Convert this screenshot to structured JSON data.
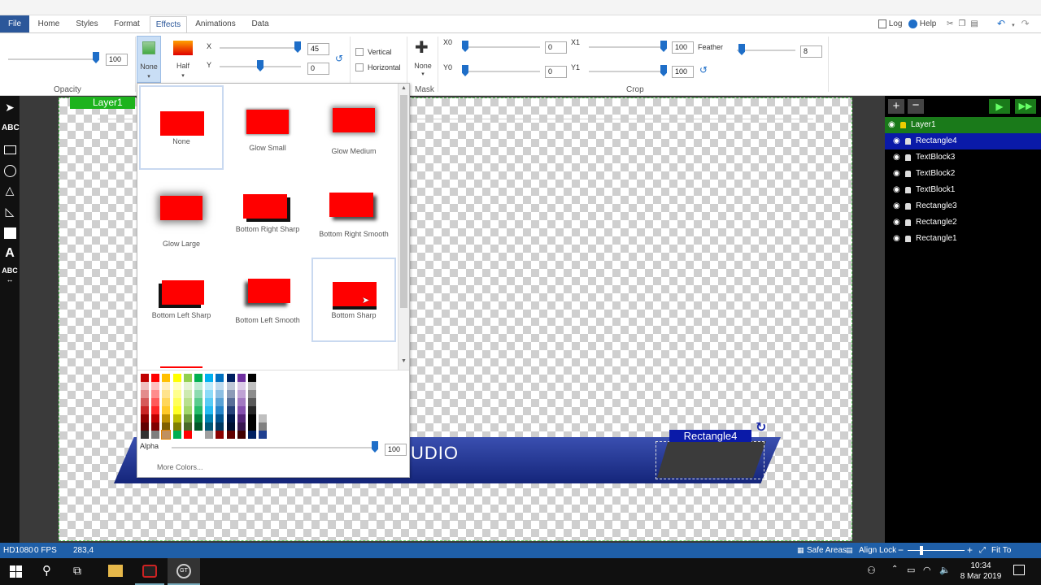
{
  "menu": {
    "tabs": [
      "File",
      "Home",
      "Styles",
      "Format",
      "Effects",
      "Animations",
      "Data"
    ],
    "active_tab": "Effects",
    "right": {
      "log": "Log",
      "help": "Help"
    }
  },
  "ribbon": {
    "opacity": {
      "label": "Opacity",
      "value": "100"
    },
    "shadow": {
      "none_label": "None",
      "half_label": "Half"
    },
    "xy": {
      "x_label": "X",
      "x_value": "45",
      "y_label": "Y",
      "y_value": "0"
    },
    "flip": {
      "vertical": "Vertical",
      "horizontal": "Horizontal"
    },
    "mask": {
      "label": "Mask",
      "none_label": "None"
    },
    "crop": {
      "label": "Crop",
      "x0_label": "X0",
      "x0_value": "0",
      "y0_label": "Y0",
      "y0_value": "0",
      "x1_label": "X1",
      "x1_value": "100",
      "y1_label": "Y1",
      "y1_value": "100",
      "feather_label": "Feather",
      "feather_value": "8"
    }
  },
  "canvas": {
    "layer_tag": "Layer1",
    "banner_text": "UDIO",
    "selected_tag": "Rectangle4"
  },
  "effects_dropdown": {
    "items": [
      {
        "label": "None"
      },
      {
        "label": "Glow Small"
      },
      {
        "label": "Glow Medium"
      },
      {
        "label": "Glow Large"
      },
      {
        "label": "Bottom Right Sharp"
      },
      {
        "label": "Bottom Right Smooth"
      },
      {
        "label": "Bottom Left Sharp"
      },
      {
        "label": "Bottom Left Smooth"
      },
      {
        "label": "Bottom Sharp"
      }
    ],
    "selected": "Bottom Sharp",
    "alpha_label": "Alpha",
    "alpha_value": "100",
    "more_colors": "More Colors..."
  },
  "layers_panel": {
    "items": [
      "Layer1",
      "Rectangle4",
      "TextBlock3",
      "TextBlock2",
      "TextBlock1",
      "Rectangle3",
      "Rectangle2",
      "Rectangle1"
    ],
    "selected": "Rectangle4"
  },
  "status_bar": {
    "format": "HD1080",
    "fps": "0 FPS",
    "coords": "283,4",
    "safe_areas": "Safe Areas",
    "align_lock": "Align Lock",
    "fit": "Fit To Window"
  },
  "taskbar": {
    "time": "10:34",
    "date": "8 Mar 2019"
  },
  "colors": {
    "accent": "#2b579a",
    "layer_green": "#1db31d",
    "selected_blue": "#0a1aa8",
    "banner": "#1c2d8c",
    "effect_red": "#ff0000"
  }
}
